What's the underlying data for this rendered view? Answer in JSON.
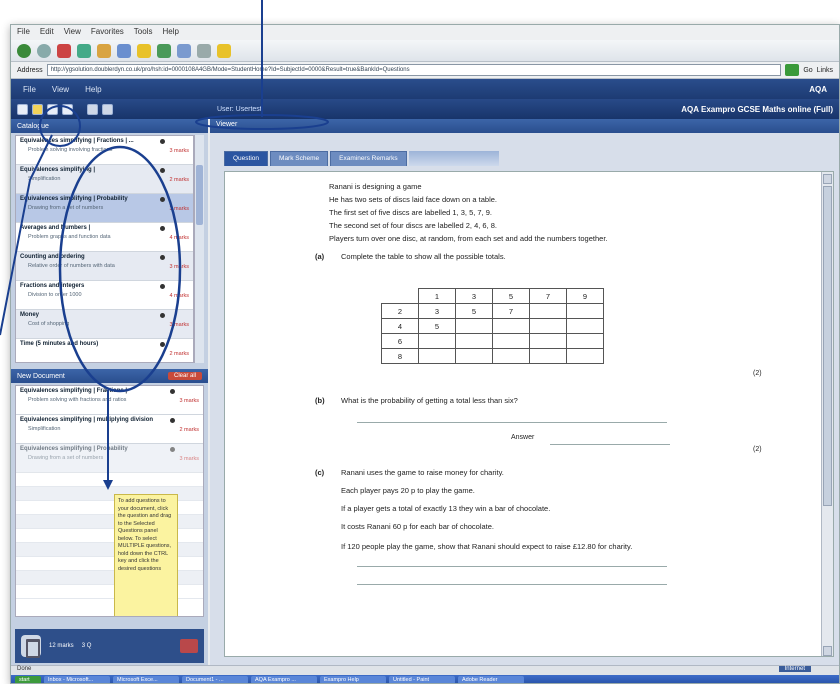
{
  "ie": {
    "menu": [
      "File",
      "Edit",
      "View",
      "Favorites",
      "Tools",
      "Help"
    ],
    "address_label": "Address",
    "address": "http://ygsolution.doublerdyn.co.uk/pro/hsh:id=0000108A4GB/Mode=StudentHome?Id=SubjectId=0000&Result=true&BankId=Questions",
    "go_label": "Go",
    "links_label": "Links"
  },
  "app": {
    "menu": [
      "File",
      "View",
      "Help"
    ],
    "logo": "AQA",
    "user_label": "User: Usertest",
    "title": "AQA Exampro GCSE Maths online (Full)"
  },
  "left": {
    "search_header": "Catalogue",
    "questions": [
      {
        "title": "Equivalences simplifying | Fractions | ...",
        "sub": "Problem solving involving fractions",
        "marks": "3 marks"
      },
      {
        "title": "Equivalences simplifying |",
        "sub": "Simplification",
        "marks": "2 marks"
      },
      {
        "title": "Equivalences simplifying | Probability",
        "sub": "Drawing from a set of numbers",
        "marks": "3 marks"
      },
      {
        "title": "Averages and Numbers |",
        "sub": "Problem graphs and function data",
        "marks": "4 marks"
      },
      {
        "title": "Counting and ordering",
        "sub": "Relative order of numbers with data",
        "marks": "3 marks"
      },
      {
        "title": "Fractions and integers",
        "sub": "Division to order 1000",
        "marks": "4 marks"
      },
      {
        "title": "Money",
        "sub": "Cost of shopping",
        "marks": "3 marks"
      },
      {
        "title": "Time (5 minutes and hours)",
        "sub": "",
        "marks": "2 marks"
      }
    ],
    "doc_header": "New Document",
    "clear_all": "Clear all",
    "doc_items": [
      {
        "title": "Equivalences simplifying | Fractions |",
        "sub": "Problem solving with fractions and ratios",
        "marks": "3 marks"
      },
      {
        "title": "Equivalences simplifying | multiplying division",
        "sub": "Simplification",
        "marks": "2 marks"
      },
      {
        "title": "Equivalences simplifying | Probability",
        "sub": "Drawing from a set of numbers",
        "marks": "3 marks"
      }
    ],
    "tooltip": "To add questions to your document, click the question and drag to the Selected Questions panel below. To select MULTIPLE questions, hold down the CTRL key and click the desired questions",
    "count_label": "12 marks",
    "total_label": "3 Q"
  },
  "right": {
    "header": "Viewer",
    "tabs": [
      "Question",
      "Mark Scheme",
      "Examiners Remarks"
    ],
    "intro": [
      "Ranani is designing a game",
      "He has two sets of discs laid face down on a table.",
      "The first set of five discs are labelled 1, 3, 5, 7, 9.",
      "The second set of four discs are labelled 2, 4, 6, 8.",
      "Players turn over one disc, at random, from each set and add the numbers together."
    ],
    "part_a_label": "(a)",
    "part_a": "Complete the table to show all the possible totals.",
    "table_header": [
      "1",
      "3",
      "5",
      "7",
      "9"
    ],
    "table_rows": [
      {
        "head": "2",
        "cells": [
          "3",
          "5",
          "7",
          "",
          ""
        ]
      },
      {
        "head": "4",
        "cells": [
          "5",
          "",
          "",
          "",
          ""
        ]
      },
      {
        "head": "6",
        "cells": [
          "",
          "",
          "",
          "",
          ""
        ]
      },
      {
        "head": "8",
        "cells": [
          "",
          "",
          "",
          "",
          ""
        ]
      }
    ],
    "marks_a": "(2)",
    "part_b_label": "(b)",
    "part_b": "What is the probability of getting a total less than six?",
    "answer_label": "Answer",
    "marks_b": "(2)",
    "part_c_label": "(c)",
    "part_c": [
      "Ranani uses the game to raise money for charity.",
      "Each player pays 20 p to play the game.",
      "If a player gets a total of exactly 13 they win a bar of chocolate.",
      "It costs Ranani 60 p for each bar of chocolate.",
      "If 120 people play the game, show that Ranani should expect to raise £12.80 for charity."
    ]
  },
  "status": {
    "left": "Done",
    "right": "Internet",
    "taskbar": [
      "start",
      "Inbox - Microsoft...",
      "Microsoft Exce...",
      "Document1 - ...",
      "AQA Exampro ...",
      "Exampro Help",
      "Untitled - Paint",
      "Adobe Reader"
    ]
  },
  "colors": {
    "app_blue": "#1d3b73",
    "annotation_blue": "#1a3f8f",
    "tooltip_yellow": "#fbf3a0",
    "marks_red": "#c03030"
  }
}
